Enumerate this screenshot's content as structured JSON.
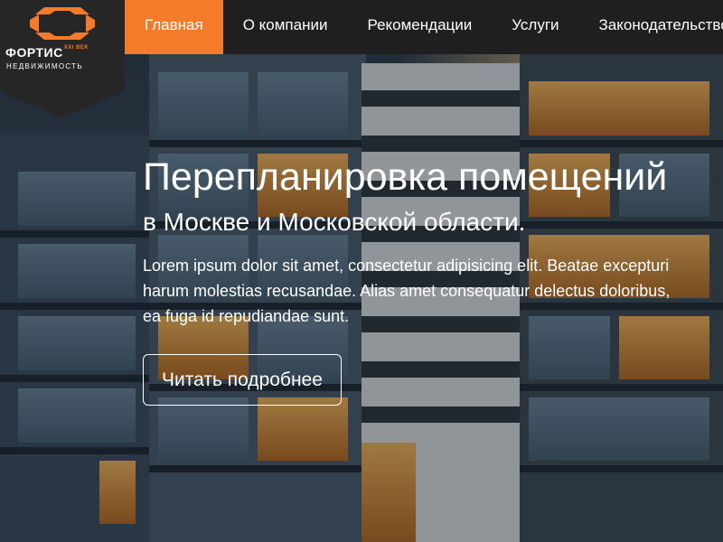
{
  "brand": {
    "name": "ФОРТИС",
    "name_superscript": "XXI ВЕК",
    "tagline": "НЕДВИЖИМОСТЬ",
    "accent_color": "#f47b2a"
  },
  "nav": {
    "items": [
      {
        "label": "Главная",
        "active": true
      },
      {
        "label": "О компании",
        "active": false
      },
      {
        "label": "Рекомендации",
        "active": false
      },
      {
        "label": "Услуги",
        "active": false
      },
      {
        "label": "Законодательство",
        "active": false
      }
    ]
  },
  "hero": {
    "title": "Перепланировка помещений",
    "subtitle": "в Москве и Московской области.",
    "text": "Lorem ipsum dolor sit amet, consectetur adipisicing elit. Beatae excepturi harum molestias recusandae. Alias amet consequatur delectus doloribus, ea fuga id repudiandae sunt.",
    "button_label": "Читать подробнее"
  }
}
